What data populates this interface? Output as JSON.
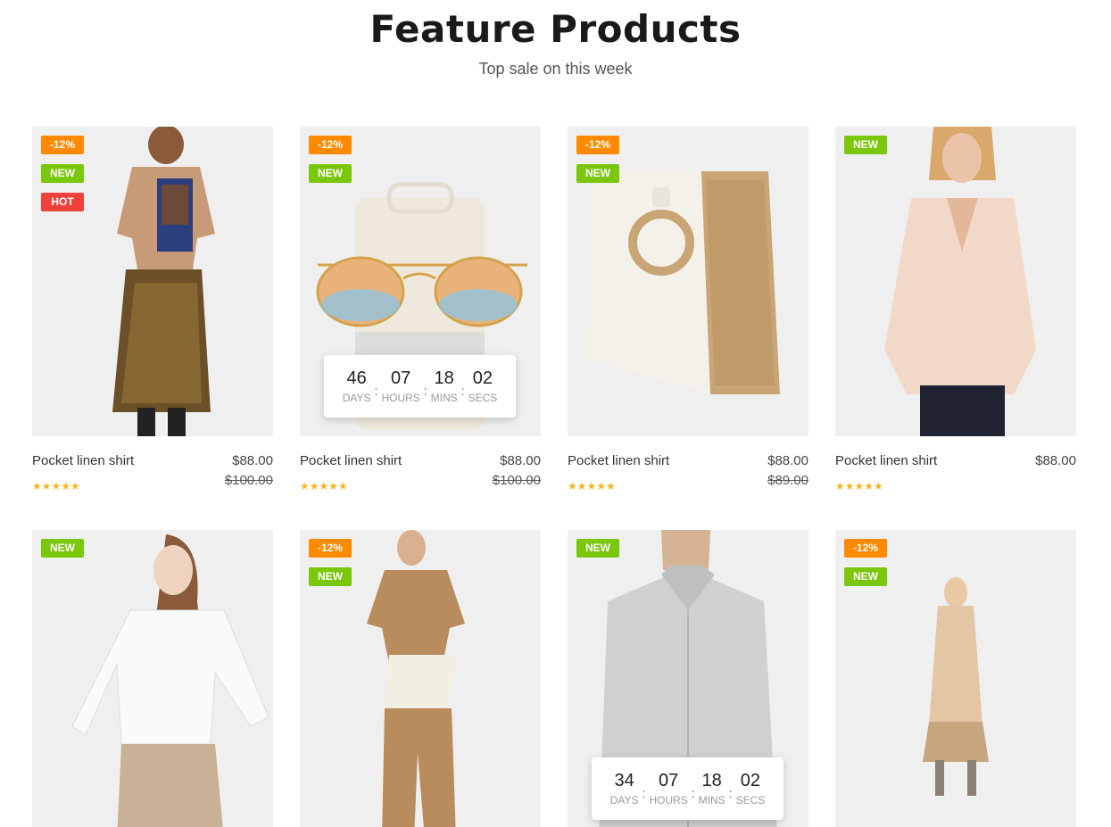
{
  "header": {
    "title": "Feature Products",
    "subtitle": "Top sale on this week"
  },
  "products": [
    {
      "name": "Pocket linen shirt",
      "price": "$88.00",
      "old_price": "$100.00",
      "rating": 5,
      "badges": [
        "-12%",
        "NEW",
        "HOT"
      ],
      "image": "woman-tshirt-sequin-skirt"
    },
    {
      "name": "Pocket linen shirt",
      "price": "$88.00",
      "old_price": "$100.00",
      "rating": 5,
      "badges": [
        "-12%",
        "NEW"
      ],
      "image": "sunglasses",
      "countdown": {
        "days": "46",
        "hours": "07",
        "mins": "18",
        "secs": "02"
      }
    },
    {
      "name": "Pocket linen shirt",
      "price": "$88.00",
      "old_price": "$89.00",
      "rating": 5,
      "badges": [
        "-12%",
        "NEW"
      ],
      "image": "straw-bag"
    },
    {
      "name": "Pocket linen shirt",
      "price": "$88.00",
      "old_price": "",
      "rating": 5,
      "badges": [
        "NEW"
      ],
      "image": "woman-pink-blouse"
    },
    {
      "name": "",
      "badges": [
        "NEW"
      ],
      "image": "woman-white-top"
    },
    {
      "name": "",
      "badges": [
        "-12%",
        "NEW"
      ],
      "image": "man-camel-outfit"
    },
    {
      "name": "",
      "badges": [
        "NEW"
      ],
      "image": "man-grey-coat",
      "countdown": {
        "days": "34",
        "hours": "07",
        "mins": "18",
        "secs": "02"
      }
    },
    {
      "name": "",
      "badges": [
        "-12%",
        "NEW"
      ],
      "image": "woman-camel-coat"
    }
  ],
  "countdown_labels": {
    "days": "DAYS",
    "hours": "HOURS",
    "mins": "MINS",
    "secs": "SECS"
  },
  "colors": {
    "badge_sale": "#ff8a00",
    "badge_new": "#7ac70c",
    "badge_hot": "#f0413a",
    "star": "#f5b623",
    "image_bg": "#efefef"
  }
}
